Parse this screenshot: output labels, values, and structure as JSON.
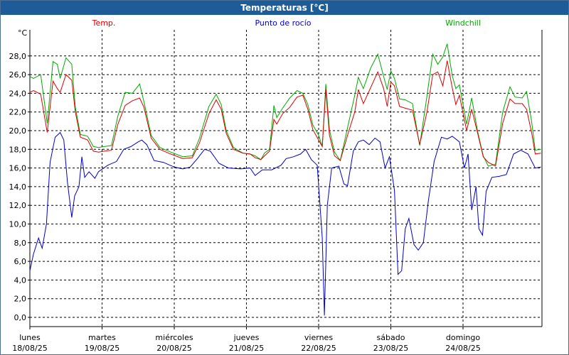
{
  "window": {
    "title": "Temperaturas [°C]"
  },
  "colors": {
    "titlebar": "#1e5c97",
    "temp": "#dd0000",
    "dew": "#0000cc",
    "windchill": "#00aa00",
    "grid": "#000000",
    "axis": "#000000"
  },
  "chart_data": {
    "type": "line",
    "ylabel": "°C",
    "ylim": [
      0,
      30
    ],
    "yticks": [
      "0,0",
      "2,0",
      "4,0",
      "6,0",
      "8,0",
      "10,0",
      "12,0",
      "14,0",
      "16,0",
      "18,0",
      "20,0",
      "22,0",
      "24,0",
      "26,0",
      "28,0"
    ],
    "xlim": [
      0,
      7
    ],
    "xticks": [
      {
        "x": 0,
        "day": "lunes",
        "date": "18/08/25"
      },
      {
        "x": 1,
        "day": "martes",
        "date": "19/08/25"
      },
      {
        "x": 2,
        "day": "miércoles",
        "date": "20/08/25"
      },
      {
        "x": 3,
        "day": "jueves",
        "date": "21/08/25"
      },
      {
        "x": 4,
        "day": "viernes",
        "date": "22/08/25"
      },
      {
        "x": 5,
        "day": "sábado",
        "date": "23/08/25"
      },
      {
        "x": 6,
        "day": "domingo",
        "date": "24/08/25"
      }
    ],
    "grid": true,
    "legend": "top",
    "series": [
      {
        "name": "Temp.",
        "color": "#dd0000",
        "points": [
          [
            0,
            24.1
          ],
          [
            0.05,
            24.3
          ],
          [
            0.15,
            23.9
          ],
          [
            0.24,
            19.8
          ],
          [
            0.32,
            25.3
          ],
          [
            0.38,
            24.5
          ],
          [
            0.42,
            24.1
          ],
          [
            0.5,
            26.0
          ],
          [
            0.58,
            25.4
          ],
          [
            0.63,
            22.0
          ],
          [
            0.7,
            19.3
          ],
          [
            0.8,
            19.0
          ],
          [
            0.88,
            17.8
          ],
          [
            0.95,
            17.7
          ],
          [
            1.03,
            17.8
          ],
          [
            1.13,
            17.9
          ],
          [
            1.22,
            20.7
          ],
          [
            1.32,
            22.7
          ],
          [
            1.42,
            23.2
          ],
          [
            1.52,
            23.5
          ],
          [
            1.58,
            22.5
          ],
          [
            1.68,
            19.2
          ],
          [
            1.8,
            18.0
          ],
          [
            1.95,
            17.5
          ],
          [
            2.12,
            17.0
          ],
          [
            2.25,
            17.1
          ],
          [
            2.35,
            18.7
          ],
          [
            2.48,
            21.8
          ],
          [
            2.58,
            23.3
          ],
          [
            2.65,
            22.3
          ],
          [
            2.72,
            19.7
          ],
          [
            2.82,
            18.0
          ],
          [
            2.95,
            17.6
          ],
          [
            3.05,
            17.5
          ],
          [
            3.12,
            17.1
          ],
          [
            3.2,
            16.9
          ],
          [
            3.25,
            17.3
          ],
          [
            3.32,
            17.8
          ],
          [
            3.38,
            21.2
          ],
          [
            3.42,
            20.7
          ],
          [
            3.5,
            21.8
          ],
          [
            3.6,
            22.5
          ],
          [
            3.7,
            23.6
          ],
          [
            3.78,
            23.8
          ],
          [
            3.85,
            22.3
          ],
          [
            3.92,
            20.1
          ],
          [
            4.0,
            19.0
          ],
          [
            4.05,
            18.3
          ],
          [
            4.1,
            24.4
          ],
          [
            4.15,
            19.5
          ],
          [
            4.22,
            17.3
          ],
          [
            4.3,
            16.8
          ],
          [
            4.4,
            19.5
          ],
          [
            4.5,
            22.0
          ],
          [
            4.55,
            24.4
          ],
          [
            4.62,
            22.9
          ],
          [
            4.72,
            24.6
          ],
          [
            4.82,
            26.3
          ],
          [
            4.9,
            24.5
          ],
          [
            4.95,
            22.6
          ],
          [
            5.0,
            25.2
          ],
          [
            5.05,
            24.8
          ],
          [
            5.12,
            22.6
          ],
          [
            5.2,
            22.4
          ],
          [
            5.3,
            22.2
          ],
          [
            5.4,
            18.5
          ],
          [
            5.5,
            22.0
          ],
          [
            5.58,
            26.0
          ],
          [
            5.65,
            26.3
          ],
          [
            5.72,
            24.8
          ],
          [
            5.78,
            27.5
          ],
          [
            5.85,
            24.6
          ],
          [
            5.9,
            22.8
          ],
          [
            5.95,
            23.8
          ],
          [
            6.05,
            20.0
          ],
          [
            6.12,
            22.3
          ],
          [
            6.2,
            19.8
          ],
          [
            6.28,
            17.2
          ],
          [
            6.35,
            16.6
          ],
          [
            6.45,
            16.2
          ],
          [
            6.55,
            20.8
          ],
          [
            6.65,
            23.4
          ],
          [
            6.72,
            22.9
          ],
          [
            6.82,
            22.9
          ],
          [
            6.88,
            22.3
          ],
          [
            6.95,
            19.8
          ],
          [
            7.0,
            17.5
          ],
          [
            7.08,
            17.6
          ]
        ]
      },
      {
        "name": "Punto de rocío",
        "color": "#0000cc",
        "points": [
          [
            0,
            5.0
          ],
          [
            0.05,
            6.8
          ],
          [
            0.12,
            8.5
          ],
          [
            0.17,
            7.4
          ],
          [
            0.23,
            10.0
          ],
          [
            0.28,
            16.6
          ],
          [
            0.35,
            19.3
          ],
          [
            0.42,
            19.8
          ],
          [
            0.47,
            19.0
          ],
          [
            0.52,
            14.5
          ],
          [
            0.58,
            10.7
          ],
          [
            0.62,
            13.0
          ],
          [
            0.68,
            14.0
          ],
          [
            0.72,
            17.2
          ],
          [
            0.76,
            15.0
          ],
          [
            0.82,
            15.6
          ],
          [
            0.9,
            14.9
          ],
          [
            0.95,
            15.6
          ],
          [
            1.08,
            16.3
          ],
          [
            1.2,
            16.7
          ],
          [
            1.3,
            18.0
          ],
          [
            1.4,
            18.3
          ],
          [
            1.5,
            18.8
          ],
          [
            1.55,
            19.0
          ],
          [
            1.62,
            18.5
          ],
          [
            1.72,
            16.8
          ],
          [
            1.85,
            16.6
          ],
          [
            2.0,
            16.1
          ],
          [
            2.12,
            15.9
          ],
          [
            2.22,
            16.1
          ],
          [
            2.32,
            17.0
          ],
          [
            2.42,
            18.0
          ],
          [
            2.5,
            17.8
          ],
          [
            2.62,
            16.5
          ],
          [
            2.75,
            16.0
          ],
          [
            2.92,
            15.9
          ],
          [
            3.05,
            16.0
          ],
          [
            3.12,
            15.2
          ],
          [
            3.22,
            15.8
          ],
          [
            3.35,
            15.8
          ],
          [
            3.48,
            16.3
          ],
          [
            3.55,
            17.0
          ],
          [
            3.65,
            17.2
          ],
          [
            3.75,
            17.5
          ],
          [
            3.82,
            18.0
          ],
          [
            3.9,
            16.9
          ],
          [
            3.98,
            16.3
          ],
          [
            4.05,
            8.5
          ],
          [
            4.08,
            0.2
          ],
          [
            4.12,
            12.0
          ],
          [
            4.18,
            16.0
          ],
          [
            4.28,
            16.2
          ],
          [
            4.35,
            14.3
          ],
          [
            4.4,
            14.1
          ],
          [
            4.48,
            17.8
          ],
          [
            4.55,
            18.8
          ],
          [
            4.62,
            19.0
          ],
          [
            4.7,
            18.5
          ],
          [
            4.78,
            19.2
          ],
          [
            4.85,
            18.8
          ],
          [
            4.92,
            16.0
          ],
          [
            4.98,
            17.2
          ],
          [
            5.05,
            13.6
          ],
          [
            5.1,
            4.6
          ],
          [
            5.15,
            5.0
          ],
          [
            5.2,
            9.5
          ],
          [
            5.25,
            10.6
          ],
          [
            5.32,
            7.8
          ],
          [
            5.38,
            7.2
          ],
          [
            5.45,
            8.0
          ],
          [
            5.52,
            12.5
          ],
          [
            5.6,
            16.7
          ],
          [
            5.7,
            19.3
          ],
          [
            5.78,
            19.1
          ],
          [
            5.85,
            19.4
          ],
          [
            5.95,
            18.8
          ],
          [
            6.02,
            16.0
          ],
          [
            6.07,
            17.5
          ],
          [
            6.12,
            11.5
          ],
          [
            6.18,
            14.0
          ],
          [
            6.22,
            9.5
          ],
          [
            6.27,
            8.8
          ],
          [
            6.32,
            13.5
          ],
          [
            6.4,
            15.0
          ],
          [
            6.5,
            15.1
          ],
          [
            6.6,
            15.3
          ],
          [
            6.7,
            17.5
          ],
          [
            6.8,
            17.9
          ],
          [
            6.9,
            17.5
          ],
          [
            7.0,
            16.0
          ],
          [
            7.08,
            16.1
          ]
        ]
      },
      {
        "name": "Windchill",
        "color": "#00aa00",
        "points": [
          [
            0,
            25.8
          ],
          [
            0.05,
            25.6
          ],
          [
            0.15,
            26.0
          ],
          [
            0.24,
            20.8
          ],
          [
            0.32,
            27.4
          ],
          [
            0.38,
            27.1
          ],
          [
            0.42,
            25.6
          ],
          [
            0.5,
            27.8
          ],
          [
            0.58,
            27.1
          ],
          [
            0.63,
            22.5
          ],
          [
            0.7,
            19.6
          ],
          [
            0.8,
            19.4
          ],
          [
            0.88,
            18.3
          ],
          [
            0.95,
            18.2
          ],
          [
            1.03,
            18.3
          ],
          [
            1.13,
            18.4
          ],
          [
            1.22,
            21.6
          ],
          [
            1.32,
            24.1
          ],
          [
            1.42,
            24.0
          ],
          [
            1.52,
            25.0
          ],
          [
            1.58,
            23.1
          ],
          [
            1.68,
            19.5
          ],
          [
            1.8,
            18.2
          ],
          [
            1.95,
            17.7
          ],
          [
            2.12,
            17.2
          ],
          [
            2.25,
            17.3
          ],
          [
            2.35,
            19.2
          ],
          [
            2.48,
            22.6
          ],
          [
            2.58,
            23.9
          ],
          [
            2.65,
            22.8
          ],
          [
            2.72,
            20.0
          ],
          [
            2.82,
            18.2
          ],
          [
            2.95,
            17.6
          ],
          [
            3.05,
            17.5
          ],
          [
            3.12,
            17.3
          ],
          [
            3.2,
            16.9
          ],
          [
            3.25,
            17.6
          ],
          [
            3.32,
            18.0
          ],
          [
            3.38,
            22.7
          ],
          [
            3.42,
            21.4
          ],
          [
            3.5,
            22.4
          ],
          [
            3.6,
            23.5
          ],
          [
            3.7,
            24.3
          ],
          [
            3.78,
            24.0
          ],
          [
            3.85,
            22.8
          ],
          [
            3.92,
            20.6
          ],
          [
            4.0,
            19.5
          ],
          [
            4.05,
            18.3
          ],
          [
            4.1,
            25.0
          ],
          [
            4.15,
            20.1
          ],
          [
            4.22,
            17.7
          ],
          [
            4.3,
            16.8
          ],
          [
            4.4,
            20.3
          ],
          [
            4.5,
            23.8
          ],
          [
            4.55,
            25.7
          ],
          [
            4.62,
            24.5
          ],
          [
            4.72,
            26.7
          ],
          [
            4.82,
            28.2
          ],
          [
            4.9,
            25.8
          ],
          [
            4.95,
            24.4
          ],
          [
            5.0,
            26.4
          ],
          [
            5.05,
            25.6
          ],
          [
            5.12,
            23.4
          ],
          [
            5.2,
            23.3
          ],
          [
            5.3,
            22.9
          ],
          [
            5.4,
            18.4
          ],
          [
            5.5,
            23.7
          ],
          [
            5.58,
            28.2
          ],
          [
            5.65,
            27.1
          ],
          [
            5.72,
            27.9
          ],
          [
            5.78,
            29.3
          ],
          [
            5.85,
            25.9
          ],
          [
            5.9,
            24.5
          ],
          [
            5.95,
            24.9
          ],
          [
            6.05,
            20.7
          ],
          [
            6.12,
            23.5
          ],
          [
            6.2,
            20.0
          ],
          [
            6.28,
            17.3
          ],
          [
            6.35,
            16.2
          ],
          [
            6.45,
            16.4
          ],
          [
            6.55,
            22.0
          ],
          [
            6.65,
            24.7
          ],
          [
            6.72,
            23.6
          ],
          [
            6.82,
            23.5
          ],
          [
            6.88,
            24.2
          ],
          [
            6.95,
            21.0
          ],
          [
            7.0,
            17.9
          ],
          [
            7.08,
            18.0
          ]
        ]
      }
    ]
  }
}
